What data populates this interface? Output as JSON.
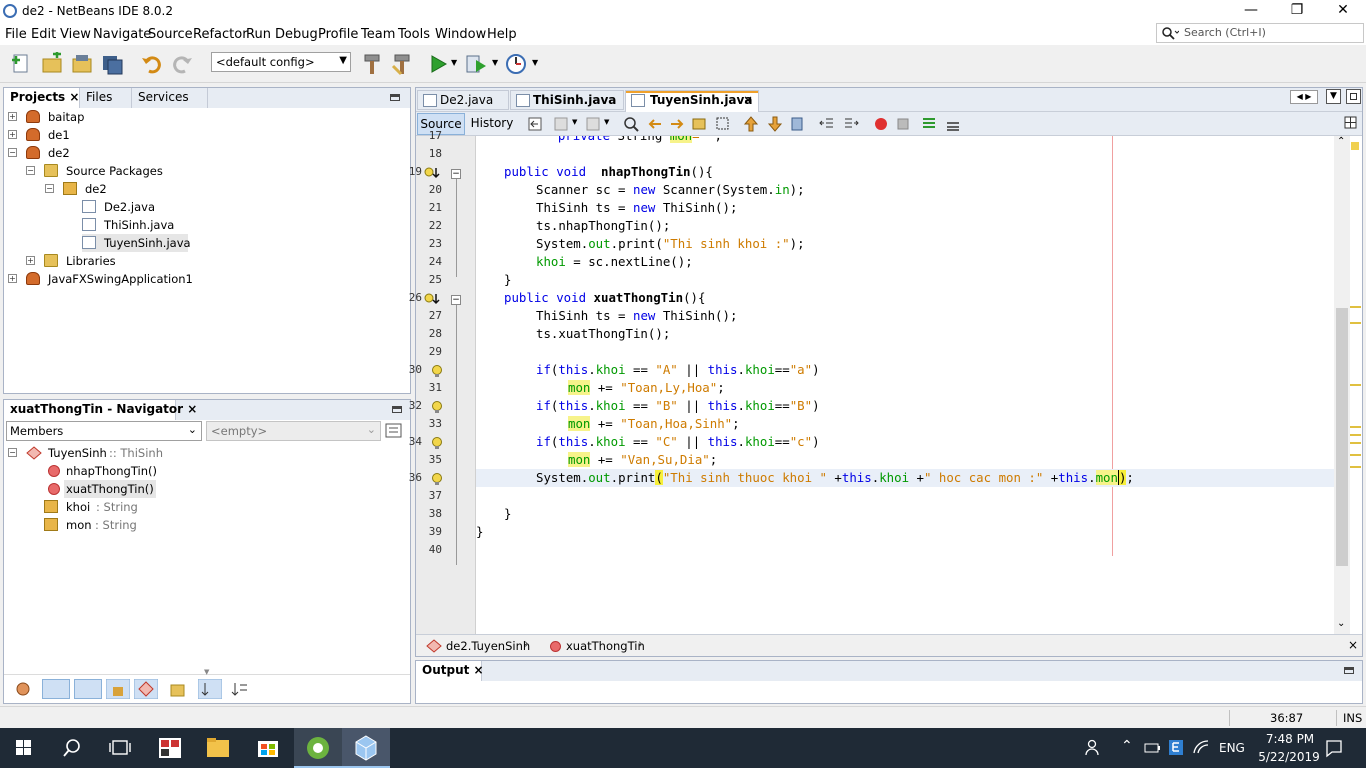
{
  "window": {
    "title": "de2 - NetBeans IDE 8.0.2",
    "min": "—",
    "max": "❐",
    "close": "✕"
  },
  "menu": [
    "File",
    "Edit",
    "View",
    "Navigate",
    "Source",
    "Refactor",
    "Run",
    "Debug",
    "Profile",
    "Team",
    "Tools",
    "Window",
    "Help"
  ],
  "search": {
    "placeholder": "Search (Ctrl+I)"
  },
  "toolbar": {
    "config": "<default config>"
  },
  "projects": {
    "tabs": [
      "Projects",
      "Files",
      "Services"
    ],
    "tree": [
      "baitap",
      "de1",
      "de2",
      "Source Packages",
      "de2",
      "De2.java",
      "ThiSinh.java",
      "TuyenSinh.java",
      "Libraries",
      "JavaFXSwingApplication1"
    ]
  },
  "navigator": {
    "title": "xuatThongTin - Navigator",
    "filter": "Members",
    "empty": "<empty>",
    "root": "TuyenSinh",
    "root_super": ":: ThiSinh",
    "members": [
      {
        "name": "nhapThongTin()",
        "type": ""
      },
      {
        "name": "xuatThongTin()",
        "type": ""
      },
      {
        "name": "khoi",
        "type": ": String"
      },
      {
        "name": "mon",
        "type": ": String"
      }
    ]
  },
  "editor": {
    "tabs": [
      "De2.java",
      "ThiSinh.java",
      "TuyenSinh.java"
    ],
    "source": "Source",
    "history": "History",
    "line_numbers": [
      "17",
      "18",
      "19",
      "20",
      "21",
      "22",
      "23",
      "24",
      "25",
      "26",
      "27",
      "28",
      "29",
      "30",
      "31",
      "32",
      "33",
      "34",
      "35",
      "36",
      "37",
      "38",
      "39",
      "40"
    ],
    "breadcrumb": [
      "de2.TuyenSinh",
      "xuatThongTin"
    ]
  },
  "output": {
    "title": "Output"
  },
  "status": {
    "position": "36:87",
    "mode": "INS"
  },
  "taskbar": {
    "lang": "ENG",
    "time": "7:48 PM",
    "date": "5/22/2019"
  },
  "colors": {
    "keyword": "#0000e6",
    "string": "#ce7b00",
    "field": "#009900",
    "accent": "#3c7fb1"
  }
}
